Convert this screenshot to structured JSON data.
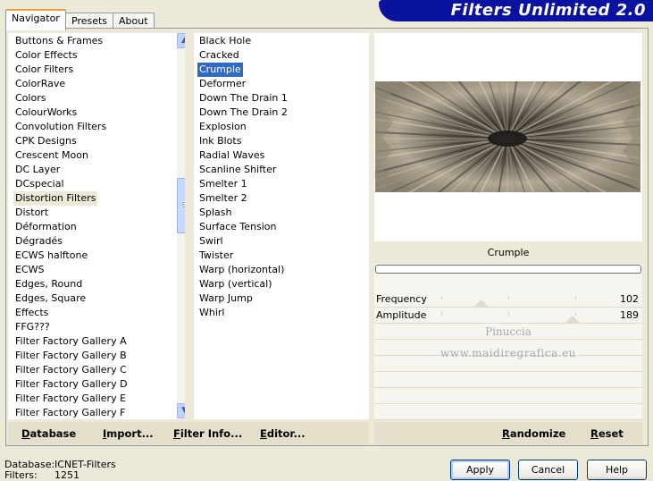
{
  "app": {
    "title": "Filters Unlimited 2.0"
  },
  "tabs": [
    {
      "label": "Navigator",
      "active": true
    },
    {
      "label": "Presets",
      "active": false
    },
    {
      "label": "About",
      "active": false
    }
  ],
  "categories": {
    "selected": "Distortion Filters",
    "items": [
      "Buttons & Frames",
      "Color Effects",
      "Color Filters",
      "ColorRave",
      "Colors",
      "ColourWorks",
      "Convolution Filters",
      "CPK Designs",
      "Crescent Moon",
      "DC Layer",
      "DCspecial",
      "Distortion Filters",
      "Distort",
      "Déformation",
      "Dégradés",
      "ECWS halftone",
      "ECWS",
      "Edges, Round",
      "Edges, Square",
      "Effects",
      "FFG???",
      "Filter Factory Gallery A",
      "Filter Factory Gallery B",
      "Filter Factory Gallery C",
      "Filter Factory Gallery D",
      "Filter Factory Gallery E",
      "Filter Factory Gallery F"
    ]
  },
  "filters": {
    "selected": "Crumple",
    "items": [
      "Black Hole",
      "Cracked",
      "Crumple",
      "Deformer",
      "Down The Drain 1",
      "Down The Drain 2",
      "Explosion",
      "Ink Blots",
      "Radial Waves",
      "Scanline Shifter",
      "Smelter 1",
      "Smelter 2",
      "Splash",
      "Surface Tension",
      "Swirl",
      "Twister",
      "Warp (horizontal)",
      "Warp (vertical)",
      "Warp Jump",
      "Whirl"
    ]
  },
  "params": {
    "title": "Crumple",
    "controls": [
      {
        "label": "Frequency",
        "value": "102",
        "level": 0.4
      },
      {
        "label": "Amplitude",
        "value": "189",
        "level": 0.74
      }
    ]
  },
  "watermark": {
    "line1": "Pinuccia",
    "line2": "www.maidiregrafica.eu"
  },
  "toolbar": {
    "database": "Database",
    "import": "Import...",
    "filter_info": "Filter Info...",
    "editor": "Editor...",
    "randomize": "Randomize",
    "reset": "Reset"
  },
  "footer": {
    "database_label": "Database:",
    "database_value": "ICNET-Filters",
    "filters_label": "Filters:",
    "filters_value": "1251"
  },
  "buttons": {
    "apply": "Apply",
    "cancel": "Cancel",
    "help": "Help"
  },
  "colors": {
    "banner": "#0a13a0",
    "selection": "#316ac5",
    "dialog_bg": "#ece9d8"
  },
  "icons": {
    "scroll_up": "chevron-up-icon",
    "scroll_down": "chevron-down-icon"
  }
}
